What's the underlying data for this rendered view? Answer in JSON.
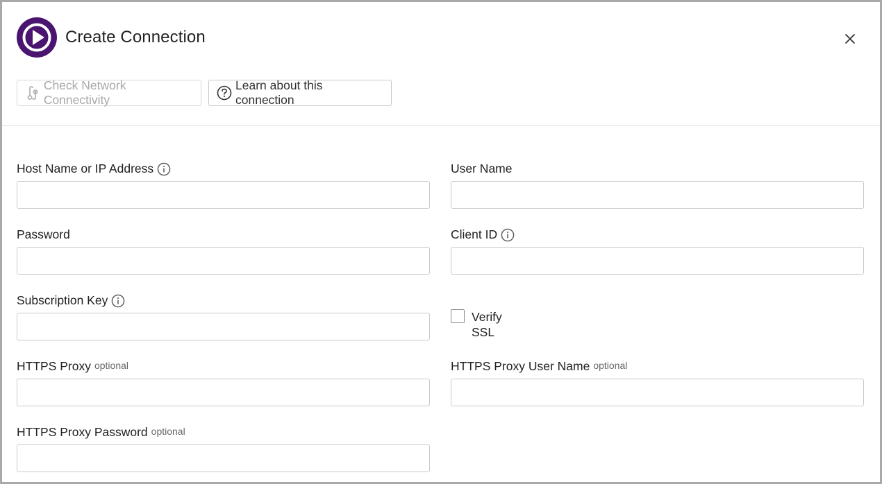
{
  "dialog": {
    "title": "Create Connection",
    "brand_color": "#4a1570",
    "close_icon": "close-icon"
  },
  "toolbar": {
    "check_network_label": "Check Network Connectivity",
    "check_network_icon": "network-check-icon",
    "check_network_disabled": true,
    "learn_label": "Learn about this connection",
    "learn_icon": "question-circle-icon"
  },
  "form": {
    "host": {
      "label": "Host Name or IP Address",
      "value": ""
    },
    "username": {
      "label": "User Name",
      "value": ""
    },
    "password": {
      "label": "Password",
      "value": ""
    },
    "client_id": {
      "label": "Client ID",
      "value": ""
    },
    "subscription_key": {
      "label": "Subscription Key",
      "value": ""
    },
    "verify_ssl": {
      "label": "Verify SSL",
      "checked": false
    },
    "https_proxy": {
      "label": "HTTPS Proxy",
      "optional": "optional",
      "value": ""
    },
    "https_proxy_user": {
      "label": "HTTPS Proxy User Name",
      "optional": "optional",
      "value": ""
    },
    "https_proxy_password": {
      "label": "HTTPS Proxy Password",
      "optional": "optional",
      "value": ""
    }
  }
}
